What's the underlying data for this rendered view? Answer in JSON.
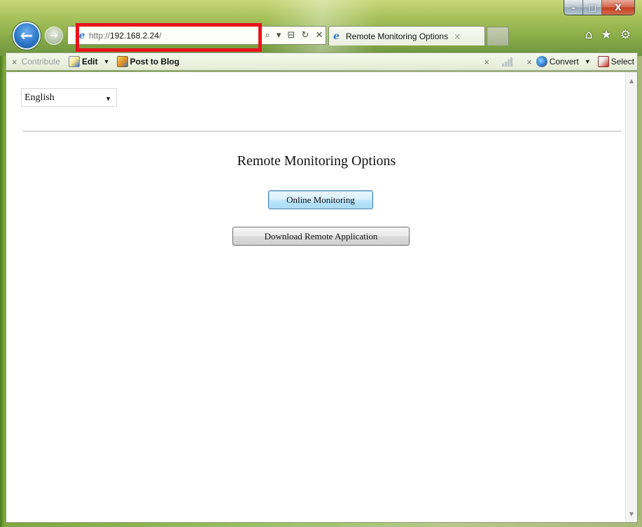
{
  "window": {
    "caption_min": "–",
    "caption_max": "□",
    "caption_close": "X"
  },
  "nav": {
    "back_glyph": "←",
    "forward_glyph": "→",
    "ie_icon_glyph": "e",
    "address": {
      "scheme": "http://",
      "host": "192.168.2.24",
      "path": "/"
    },
    "addr_tools": [
      "⌕",
      "▾",
      "⊟",
      "↻",
      "✕"
    ],
    "tab": {
      "title": "Remote Monitoring Options",
      "close": "×"
    },
    "chrome_icons": [
      "⌂",
      "★",
      "⚙"
    ],
    "highlight_color": "#e8141c"
  },
  "command_bar": {
    "close_contribute": "×",
    "contribute_label": "Contribute",
    "edit_label": "Edit",
    "edit_caret": "▼",
    "post_to_blog_label": "Post to Blog",
    "close_signal": "×",
    "close_convert": "×",
    "convert_label": "Convert",
    "convert_caret": "▼",
    "select_label": "Select"
  },
  "page": {
    "language_select": {
      "selected": "English",
      "caret": "▼"
    },
    "heading": "Remote Monitoring Options",
    "buttons": {
      "online_monitoring": "Online Monitoring",
      "download_remote_app": "Download Remote Application"
    },
    "scroll_up": "▲",
    "scroll_down": "▼"
  }
}
